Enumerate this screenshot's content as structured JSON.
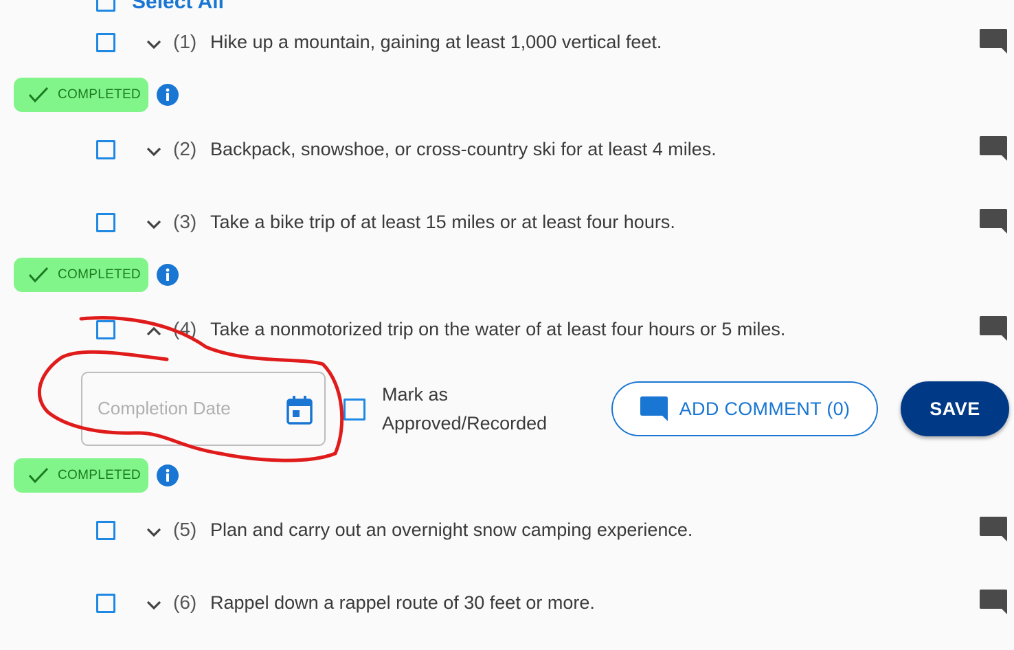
{
  "select_all": {
    "label": "Select All"
  },
  "status": {
    "completed_label": "COMPLETED"
  },
  "requirements": [
    {
      "number": "(1)",
      "text": "Hike up a mountain, gaining at least 1,000 vertical feet."
    },
    {
      "number": "(2)",
      "text": "Backpack, snowshoe, or cross-country ski for at least 4 miles."
    },
    {
      "number": "(3)",
      "text": "Take a bike trip of at least 15 miles or at least four hours."
    },
    {
      "number": "(4)",
      "text": "Take a nonmotorized trip on the water of at least four hours or 5 miles."
    },
    {
      "number": "(5)",
      "text": "Plan and carry out an overnight snow camping experience."
    },
    {
      "number": "(6)",
      "text": "Rappel down a rappel route of 30 feet or more."
    }
  ],
  "expanded_form": {
    "date_placeholder": "Completion Date",
    "approve_label": "Mark as Approved/Recorded",
    "add_comment_label": "ADD COMMENT (0)",
    "save_label": "SAVE"
  },
  "colors": {
    "accent": "#1976d2",
    "completed_bg": "#82f58a",
    "completed_text": "#1b7a21",
    "save_bg": "#003a87",
    "annotation": "#e01b1b"
  }
}
